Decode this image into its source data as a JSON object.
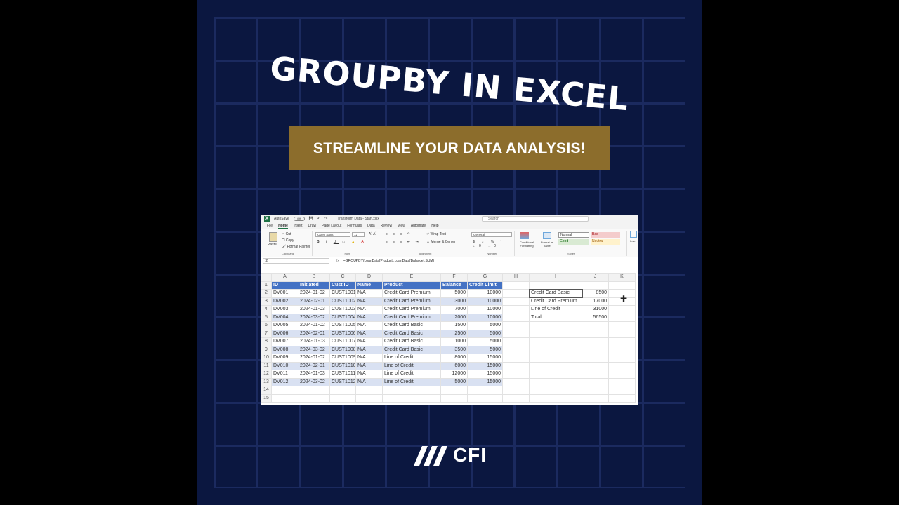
{
  "title": "GROUPBY IN EXCEL",
  "banner": "STREAMLINE YOUR DATA ANALYSIS!",
  "brand": "CFI",
  "excel": {
    "autosave": "AutoSave",
    "autosave_state": "Off",
    "filename": "Transform Data - Start.xlsx",
    "search_placeholder": "Search",
    "menu": [
      "File",
      "Home",
      "Insert",
      "Draw",
      "Page Layout",
      "Formulas",
      "Data",
      "Review",
      "View",
      "Automate",
      "Help"
    ],
    "ribbon": {
      "paste": "Paste",
      "cut": "Cut",
      "copy": "Copy",
      "format_painter": "Format Painter",
      "clipboard": "Clipboard",
      "font_name": "Open Sans",
      "font_size": "12",
      "font": "Font",
      "wrap_text": "Wrap Text",
      "merge_center": "Merge & Center",
      "alignment": "Alignment",
      "number_format": "General",
      "number": "Number",
      "conditional_formatting": "Conditional Formatting",
      "format_as_table": "Format as Table",
      "styles": "Styles",
      "style_normal": "Normal",
      "style_bad": "Bad",
      "style_good": "Good",
      "style_neutral": "Neutral",
      "insert": "Inse"
    },
    "name_box": "I2",
    "fx": "fx",
    "formula": "=GROUPBY(LoanData[Product],LoanData[Balance],SUM)",
    "columns": [
      "A",
      "B",
      "C",
      "D",
      "E",
      "F",
      "G",
      "H",
      "I",
      "J",
      "K"
    ],
    "rows": [
      "1",
      "2",
      "3",
      "4",
      "5",
      "6",
      "7",
      "8",
      "9",
      "10",
      "11",
      "12",
      "13",
      "14",
      "15"
    ],
    "headers": [
      "ID",
      "Initiated",
      "Cust ID",
      "Name",
      "Product",
      "Balance",
      "Credit Limit"
    ],
    "data": [
      [
        "DV001",
        "2024-01-02",
        "CUST1001",
        "N/A",
        "Credit Card Premium",
        "5000",
        "10000"
      ],
      [
        "DV002",
        "2024-02-01",
        "CUST1002",
        "N/A",
        "Credit Card Premium",
        "3000",
        "10000"
      ],
      [
        "DV003",
        "2024-01-03",
        "CUST1003",
        "N/A",
        "Credit Card Premium",
        "7000",
        "10000"
      ],
      [
        "DV004",
        "2024-03-02",
        "CUST1004",
        "N/A",
        "Credit Card Premium",
        "2000",
        "10000"
      ],
      [
        "DV005",
        "2024-01-02",
        "CUST1005",
        "N/A",
        "Credit Card Basic",
        "1500",
        "5000"
      ],
      [
        "DV006",
        "2024-02-01",
        "CUST1006",
        "N/A",
        "Credit Card Basic",
        "2500",
        "5000"
      ],
      [
        "DV007",
        "2024-01-03",
        "CUST1007",
        "N/A",
        "Credit Card Basic",
        "1000",
        "5000"
      ],
      [
        "DV008",
        "2024-03-02",
        "CUST1008",
        "N/A",
        "Credit Card Basic",
        "3500",
        "5000"
      ],
      [
        "DV009",
        "2024-01-02",
        "CUST1009",
        "N/A",
        "Line of Credit",
        "8000",
        "15000"
      ],
      [
        "DV010",
        "2024-02-01",
        "CUST1010",
        "N/A",
        "Line of Credit",
        "6000",
        "15000"
      ],
      [
        "DV011",
        "2024-01-03",
        "CUST1011",
        "N/A",
        "Line of Credit",
        "12000",
        "15000"
      ],
      [
        "DV012",
        "2024-03-02",
        "CUST1012",
        "N/A",
        "Line of Credit",
        "5000",
        "15000"
      ]
    ],
    "summary": [
      [
        "Credit Card Basic",
        "8500"
      ],
      [
        "Credit Card Premium",
        "17000"
      ],
      [
        "Line of Credit",
        "31000"
      ],
      [
        "Total",
        "56500"
      ]
    ]
  }
}
